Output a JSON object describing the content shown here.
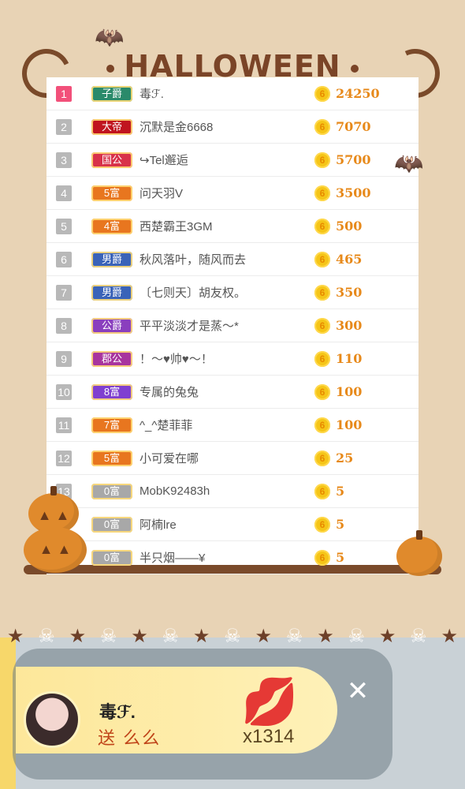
{
  "title": "HALLOWEEN",
  "coin_symbol": "6",
  "ranking": [
    {
      "rank": "1",
      "badge": "子爵",
      "badge_color": "#2a8a6a",
      "name": "毒ℱ.",
      "score": "24250"
    },
    {
      "rank": "2",
      "badge": "大帝",
      "badge_color": "#c0141f",
      "name": "沉默是金6668",
      "score": "7070"
    },
    {
      "rank": "3",
      "badge": "国公",
      "badge_color": "#d8324a",
      "name": "↪Tel邂逅",
      "score": "5700"
    },
    {
      "rank": "4",
      "badge": "5富",
      "badge_color": "#e8761f",
      "name": "问天羽V",
      "score": "3500"
    },
    {
      "rank": "5",
      "badge": "4富",
      "badge_color": "#e8761f",
      "name": "西楚霸王3GM",
      "score": "500"
    },
    {
      "rank": "6",
      "badge": "男爵",
      "badge_color": "#3a63b8",
      "name": "秋风落叶，随风而去",
      "score": "465"
    },
    {
      "rank": "7",
      "badge": "男爵",
      "badge_color": "#3a63b8",
      "name": "〔七则天〕胡友权。",
      "score": "350"
    },
    {
      "rank": "8",
      "badge": "公爵",
      "badge_color": "#8a3fbe",
      "name": "平平淡淡才是蒸～*",
      "score": "300"
    },
    {
      "rank": "9",
      "badge": "郡公",
      "badge_color": "#a8359e",
      "name": "！～♥帅♥～！",
      "score": "110"
    },
    {
      "rank": "10",
      "badge": "8富",
      "badge_color": "#7f3fd0",
      "name": "专属的兔兔",
      "score": "100"
    },
    {
      "rank": "11",
      "badge": "7富",
      "badge_color": "#e8761f",
      "name": "^_^楚菲菲",
      "score": "100"
    },
    {
      "rank": "12",
      "badge": "5富",
      "badge_color": "#e8761f",
      "name": "小可爱在哪",
      "score": "25"
    },
    {
      "rank": "13",
      "badge": "0富",
      "badge_color": "#a8a8a8",
      "name": "MobK92483h",
      "score": "5"
    },
    {
      "rank": "",
      "badge": "0富",
      "badge_color": "#a8a8a8",
      "name": "阿楠lre",
      "score": "5"
    },
    {
      "rank": "",
      "badge": "0富",
      "badge_color": "#a8a8a8",
      "name": "半只烟——¥",
      "score": "5"
    }
  ],
  "gift": {
    "sender": "毒ℱ.",
    "action": "送 么么",
    "count": "x1314",
    "close_label": "✕"
  },
  "icons": {
    "bat": "bat-icon",
    "pumpkin": "pumpkin-icon",
    "skull": "skull-icon",
    "star": "star-icon",
    "kiss": "lips-icon",
    "coin": "coin-icon"
  }
}
